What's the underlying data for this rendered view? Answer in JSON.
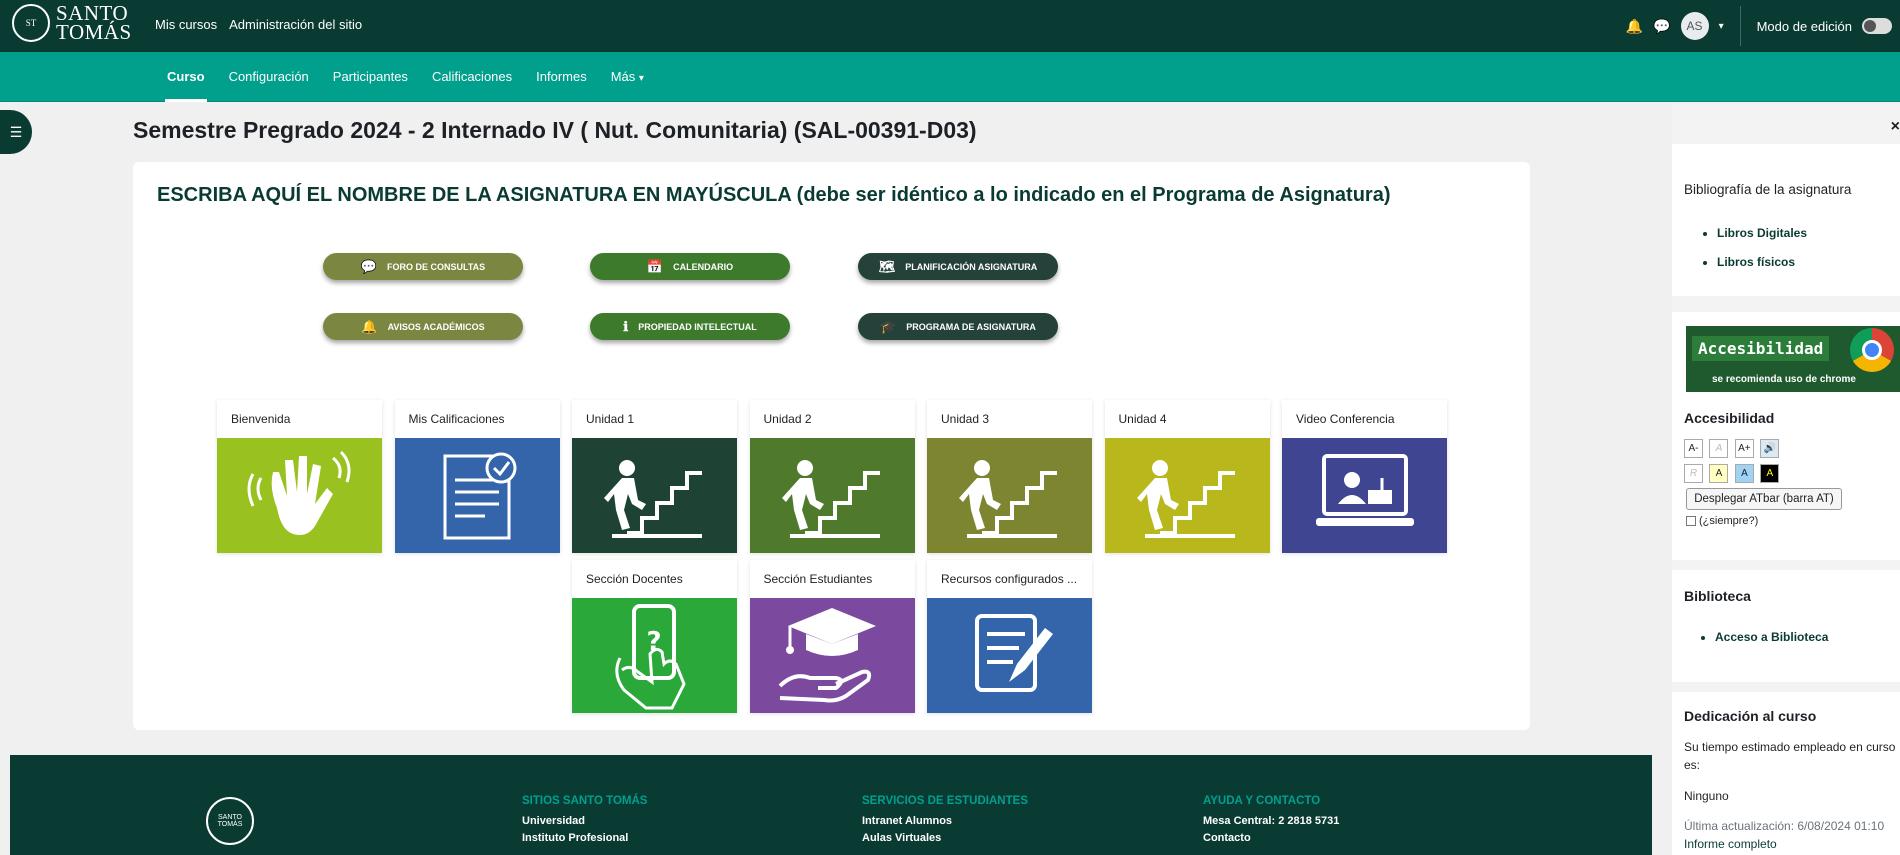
{
  "brand": {
    "name_line1": "SANTO",
    "name_line2": "TOMÁS",
    "seal": "ST"
  },
  "topnav": {
    "links": [
      "Mis cursos",
      "Administración del sitio"
    ],
    "avatar_initials": "AS",
    "edit_mode_label": "Modo de edición"
  },
  "secnav": {
    "items": [
      "Curso",
      "Configuración",
      "Participantes",
      "Calificaciones",
      "Informes",
      "Más"
    ],
    "more_chevron": "▾",
    "active": "Curso"
  },
  "page": {
    "title": "Semestre Pregrado 2024 - 2 Internado IV ( Nut. Comunitaria) (SAL-00391-D03)"
  },
  "course": {
    "heading": "ESCRIBA AQUÍ EL NOMBRE DE LA ASIGNATURA EN MAYÚSCULA (debe ser idéntico a lo indicado en el Programa de Asignatura)",
    "buttons": [
      {
        "label": "FORO DE CONSULTAS",
        "icon": "💬",
        "icon_name": "chat-icon",
        "color": "#7b8640"
      },
      {
        "label": "CALENDARIO",
        "icon": "📅",
        "icon_name": "calendar-icon",
        "color": "#3e7a2c"
      },
      {
        "label": "PLANIFICACIÓN ASIGNATURA",
        "icon": "🗺",
        "icon_name": "map-icon",
        "color": "#24413a"
      },
      {
        "label": "AVISOS ACADÉMICOS",
        "icon": "🔔",
        "icon_name": "bell-icon",
        "color": "#7b8640"
      },
      {
        "label": "PROPIEDAD INTELECTUAL",
        "icon": "ℹ",
        "icon_name": "info-icon",
        "color": "#3e7a2c"
      },
      {
        "label": "PROGRAMA DE ASIGNATURA",
        "icon": "🎓",
        "icon_name": "graduation-cap-icon",
        "color": "#24413a"
      }
    ],
    "tiles": [
      {
        "label": "Bienvenida",
        "color": "#99c11f",
        "icon_name": "waving-hand-icon"
      },
      {
        "label": "Mis Calificaciones",
        "color": "#3464aa",
        "icon_name": "document-check-icon"
      },
      {
        "label": "Unidad 1",
        "color": "#1e4234",
        "icon_name": "person-climbing-stairs-icon"
      },
      {
        "label": "Unidad 2",
        "color": "#4f7a2c",
        "icon_name": "person-climbing-stairs-icon"
      },
      {
        "label": "Unidad 3",
        "color": "#7e8531",
        "icon_name": "person-climbing-stairs-icon"
      },
      {
        "label": "Unidad 4",
        "color": "#b8b81d",
        "icon_name": "person-climbing-stairs-icon"
      },
      {
        "label": "Video Conferencia",
        "color": "#3f4590",
        "icon_name": "video-conference-icon"
      },
      {
        "label": "Sección Docentes",
        "color": "#2aa83a",
        "icon_name": "phone-help-icon"
      },
      {
        "label": "Sección Estudiantes",
        "color": "#7b4a9e",
        "icon_name": "graduation-hand-icon"
      },
      {
        "label": "Recursos configurados ...",
        "color": "#3464aa",
        "icon_name": "edit-document-icon"
      }
    ]
  },
  "sidebar": {
    "close_symbol": "×",
    "biblio": {
      "title": "Bibliografía de la asignatura",
      "links": [
        "Libros Digitales",
        "Libros físicos"
      ]
    },
    "accesibilidad_banner": {
      "title": "Accesibilidad",
      "subtitle": "se recomienda uso de chrome"
    },
    "accesibilidad": {
      "title": "Accesibilidad",
      "size_buttons": [
        "A-",
        "A",
        "A+"
      ],
      "color_buttons": [
        "R",
        "A",
        "A",
        "A"
      ],
      "atbar_button": "Desplegar ATbar (barra AT)",
      "always_label": "(¿siempre?)"
    },
    "biblioteca": {
      "title": "Biblioteca",
      "links": [
        "Acceso a Biblioteca"
      ]
    },
    "dedicacion": {
      "title": "Dedicación al curso",
      "text": "Su tiempo estimado empleado en curso es:",
      "value": "Ninguno",
      "updated": "Última actualización: 6/08/2024 01:10",
      "report_link": "Informe completo"
    }
  },
  "footer": {
    "seal": "SANTO TOMÁS",
    "columns": [
      {
        "heading": "SITIOS SANTO TOMÁS",
        "items": [
          "Universidad",
          "Instituto Profesional"
        ]
      },
      {
        "heading": "SERVICIOS DE ESTUDIANTES",
        "items": [
          "Intranet Alumnos",
          "Aulas Virtuales"
        ]
      },
      {
        "heading": "AYUDA Y CONTACTO",
        "items": [
          "Mesa Central: 2 2818 5731",
          "Contacto"
        ]
      }
    ]
  }
}
